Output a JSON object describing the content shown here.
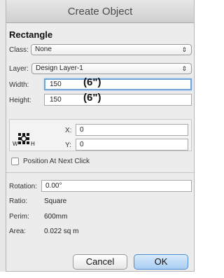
{
  "window": {
    "title": "Create Object"
  },
  "section": {
    "title": "Rectangle"
  },
  "class_field": {
    "label": "Class:",
    "value": "None"
  },
  "layer_field": {
    "label": "Layer:",
    "value": "Design Layer-1"
  },
  "width_field": {
    "label": "Width:",
    "value": "150",
    "note": "(6\")"
  },
  "height_field": {
    "label": "Height:",
    "value": "150",
    "note": "(6\")"
  },
  "position": {
    "icon_label_w": "W",
    "icon_label_h": "H",
    "x_label": "X:",
    "x_value": "0",
    "y_label": "Y:",
    "y_value": "0"
  },
  "position_checkbox": {
    "label": "Position At Next Click",
    "checked": false
  },
  "rotation_field": {
    "label": "Rotation:",
    "value": "0.00°"
  },
  "info": {
    "ratio_label": "Ratio:",
    "ratio_value": "Square",
    "perim_label": "Perim:",
    "perim_value": "600mm",
    "area_label": "Area:",
    "area_value": "0.022 sq m"
  },
  "buttons": {
    "cancel": "Cancel",
    "ok": "OK"
  },
  "colors": {
    "focus_ring": "#6ea6dc",
    "default_button": "#a8cdf3",
    "dialog_bg": "#ececec"
  }
}
